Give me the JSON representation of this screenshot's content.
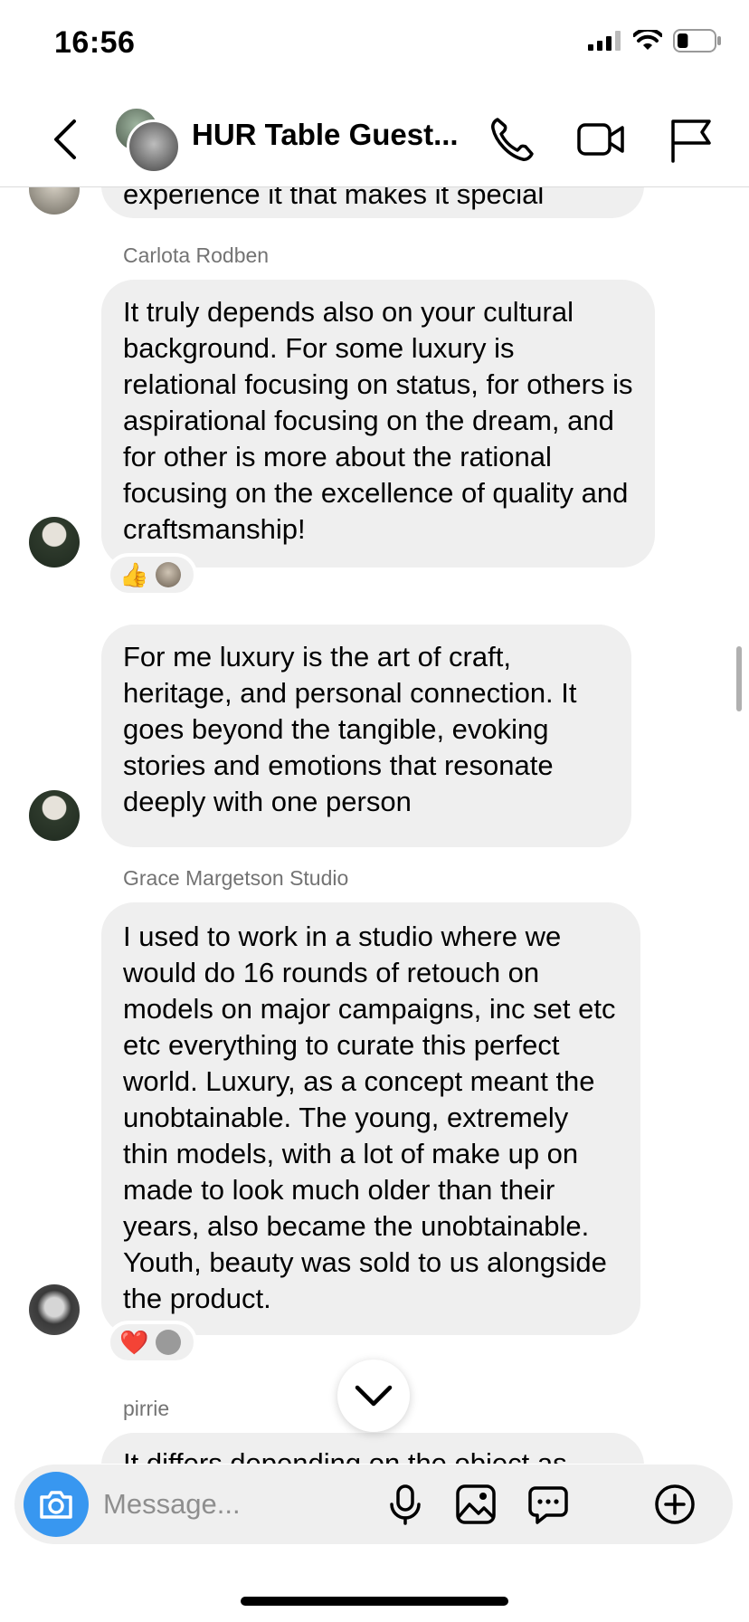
{
  "status_bar": {
    "time": "16:56",
    "battery_level": 0.3
  },
  "header": {
    "title": "HUR Table Guest..."
  },
  "messages": [
    {
      "text": "experience it that makes it special"
    },
    {
      "sender": "Carlota Rodben",
      "text": "It truly depends also on your cultural background. For some luxury is relational focusing on status, for others is aspirational focusing on the dream, and for other is more about the rational focusing on the excellence of quality and craftsmanship!",
      "reaction": "👍"
    },
    {
      "text": "For me luxury is the art of craft, heritage, and personal connection. It goes beyond the tangible, evoking stories and emotions that resonate deeply with one person"
    },
    {
      "sender": "Grace Margetson Studio",
      "text": "I used to work in a studio where we would do 16 rounds of retouch on models on major campaigns, inc set etc etc everything to curate this perfect world. Luxury, as a concept meant the unobtainable. The young, extremely thin models, with a lot of make up on made to look much older than their years, also became the unobtainable. Youth, beauty was sold to us alongside the product.",
      "reaction": "❤️"
    },
    {
      "sender": "pirrie",
      "text": "It differs depending on the object as"
    }
  ],
  "composer": {
    "placeholder": "Message..."
  },
  "icons": {
    "back": "chevron-left-icon",
    "call": "phone-icon",
    "video": "video-camera-icon",
    "report": "flag-icon",
    "camera": "camera-icon",
    "mic": "microphone-icon",
    "gallery": "image-icon",
    "sticker": "chat-bubble-icon",
    "more": "plus-circle-icon",
    "scroll_down": "chevron-down-icon"
  },
  "colors": {
    "bubble": "#efefef",
    "accent": "#3897f0",
    "sender": "#737373"
  }
}
